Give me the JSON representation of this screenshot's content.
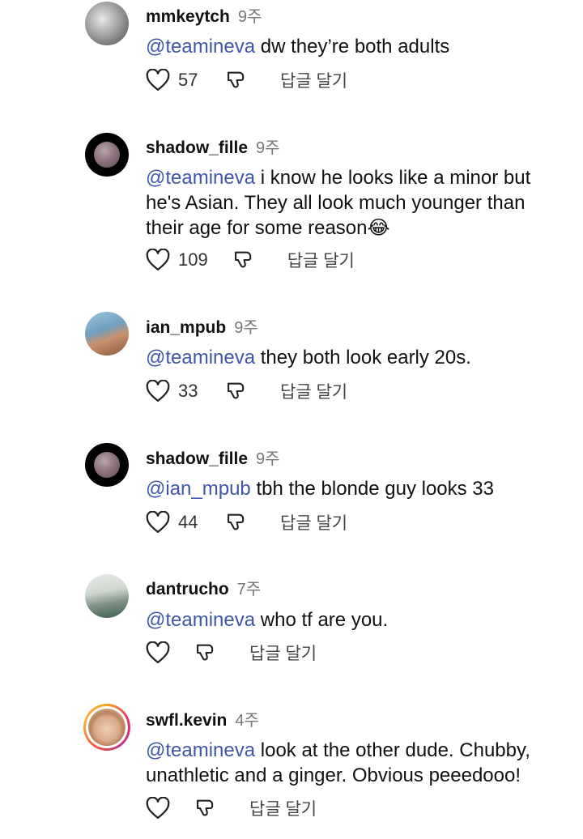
{
  "reply_label": "답글 달기",
  "comments": [
    {
      "username": "mmkeytch",
      "age": "9주",
      "mention": "@teamineva",
      "text": " dw they’re both adults",
      "likes": "57"
    },
    {
      "username": "shadow_fille",
      "age": "9주",
      "mention": "@teamineva",
      "text": " i know he looks like a minor but he's Asian. They all look much younger than their age for some reason😂",
      "likes": "109"
    },
    {
      "username": "ian_mpub",
      "age": "9주",
      "mention": "@teamineva",
      "text": " they both look early 20s.",
      "likes": "33"
    },
    {
      "username": "shadow_fille",
      "age": "9주",
      "mention": "@ian_mpub",
      "text": " tbh the blonde guy looks 33",
      "likes": "44"
    },
    {
      "username": "dantrucho",
      "age": "7주",
      "mention": "@teamineva",
      "text": " who tf are you.",
      "likes": ""
    },
    {
      "username": "swfl.kevin",
      "age": "4주",
      "mention": "@teamineva",
      "text": " look at the other dude. Chubby, unathletic and a ginger. Obvious peeedooo!",
      "likes": ""
    }
  ],
  "icons": {
    "like": "heart-icon",
    "dislike": "thumbs-down-icon"
  },
  "colors": {
    "mention": "#3f56a9",
    "text": "#111111",
    "muted": "#777777"
  }
}
